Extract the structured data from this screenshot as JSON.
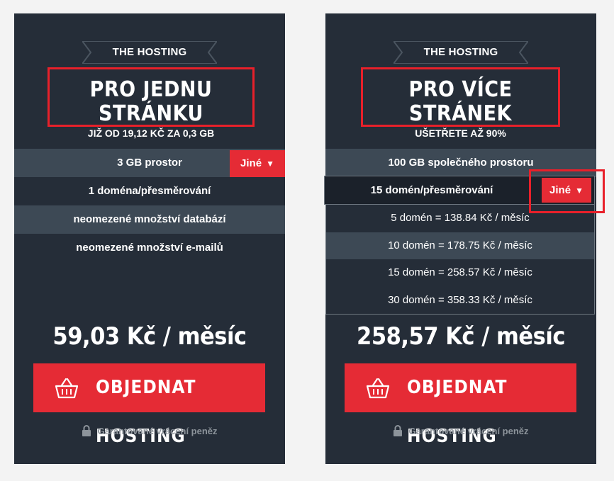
{
  "cards": [
    {
      "brand": "THE HOSTING",
      "title": "PRO JEDNU STRÁNKU",
      "subtitle": "JIŽ OD 19,12 KČ ZA 0,3 GB",
      "features": [
        "3 GB prostor",
        "1 doména/přesměrování",
        "neomezené množství databází",
        "neomezené množství e-mailů"
      ],
      "other_button": "Jiné",
      "price": "59,03 Kč / měsíc",
      "order_button": "OBJEDNAT HOSTING",
      "guarantee": "Garantované vrácení peněz"
    },
    {
      "brand": "THE HOSTING",
      "title": "PRO VÍCE STRÁNEK",
      "subtitle": "UŠETŘETE AŽ 90%",
      "features": [
        "100 GB společného prostoru"
      ],
      "dropdown": {
        "selected": "15 domén/přesměrování",
        "button": "Jiné",
        "options": [
          "5 domén = 138.84 Kč / měsíc",
          "10 domén = 178.75 Kč / měsíc",
          "15 domén = 258.57 Kč / měsíc",
          "30 domén = 358.33 Kč / měsíc"
        ]
      },
      "price": "258,57 Kč / měsíc",
      "order_button": "OBJEDNAT HOSTING",
      "guarantee": "Garantované vrácení peněz"
    }
  ],
  "colors": {
    "card_bg": "#252d38",
    "accent_red": "#e52b35",
    "row_shade": "#3d4955",
    "page_bg": "#f3f3f3"
  },
  "icons": {
    "dropdown": "triangle-down-icon",
    "cart": "basket-icon",
    "lock": "lock-icon"
  }
}
